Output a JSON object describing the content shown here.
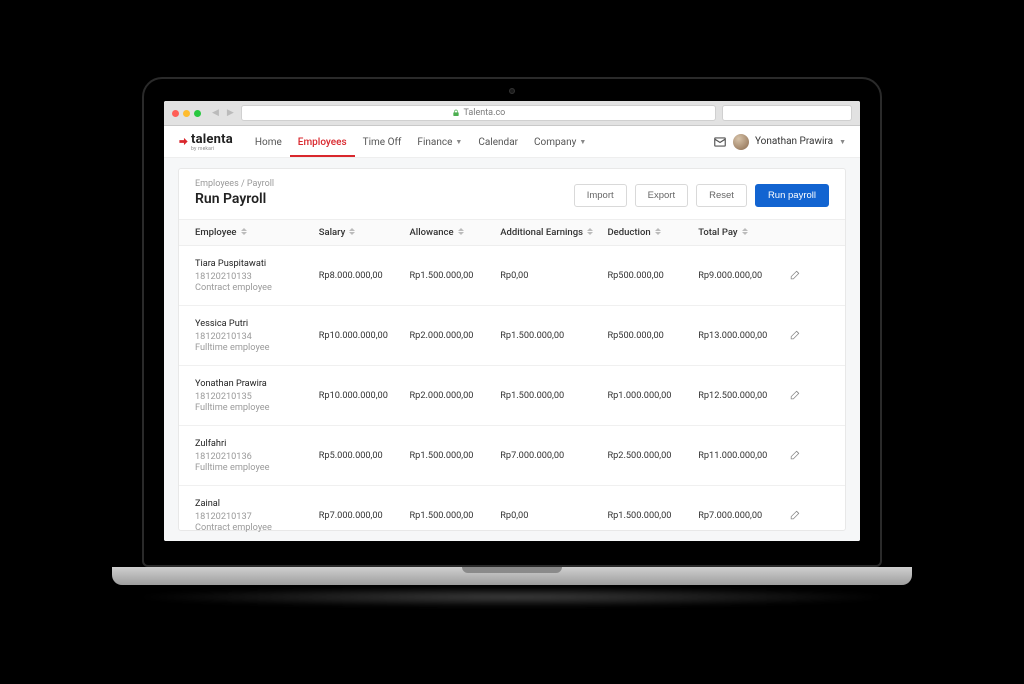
{
  "browser": {
    "url": "Talenta.co"
  },
  "brand": {
    "name": "talenta",
    "tagline": "by mekari"
  },
  "nav": {
    "items": [
      {
        "label": "Home",
        "active": false,
        "caret": false
      },
      {
        "label": "Employees",
        "active": true,
        "caret": false
      },
      {
        "label": "Time Off",
        "active": false,
        "caret": false
      },
      {
        "label": "Finance",
        "active": false,
        "caret": true
      },
      {
        "label": "Calendar",
        "active": false,
        "caret": false
      },
      {
        "label": "Company",
        "active": false,
        "caret": true
      }
    ]
  },
  "user": {
    "name": "Yonathan Prawira"
  },
  "page": {
    "breadcrumb": "Employees / Payroll",
    "title": "Run Payroll",
    "actions": {
      "import": "Import",
      "export": "Export",
      "reset": "Reset",
      "run": "Run payroll"
    }
  },
  "table": {
    "headers": {
      "employee": "Employee",
      "salary": "Salary",
      "allowance": "Allowance",
      "additional": "Additional Earnings",
      "deduction": "Deduction",
      "total": "Total Pay"
    },
    "rows": [
      {
        "name": "Tiara Puspitawati",
        "id": "18120210133",
        "type": "Contract employee",
        "salary": "Rp8.000.000,00",
        "allowance": "Rp1.500.000,00",
        "additional": "Rp0,00",
        "deduction": "Rp500.000,00",
        "total": "Rp9.000.000,00"
      },
      {
        "name": "Yessica Putri",
        "id": "18120210134",
        "type": "Fulltime employee",
        "salary": "Rp10.000.000,00",
        "allowance": "Rp2.000.000,00",
        "additional": "Rp1.500.000,00",
        "deduction": "Rp500.000,00",
        "total": "Rp13.000.000,00"
      },
      {
        "name": "Yonathan Prawira",
        "id": "18120210135",
        "type": "Fulltime employee",
        "salary": "Rp10.000.000,00",
        "allowance": "Rp2.000.000,00",
        "additional": "Rp1.500.000,00",
        "deduction": "Rp1.000.000,00",
        "total": "Rp12.500.000,00"
      },
      {
        "name": "Zulfahri",
        "id": "18120210136",
        "type": "Fulltime employee",
        "salary": "Rp5.000.000,00",
        "allowance": "Rp1.500.000,00",
        "additional": "Rp7.000.000,00",
        "deduction": "Rp2.500.000,00",
        "total": "Rp11.000.000,00"
      },
      {
        "name": "Zainal",
        "id": "18120210137",
        "type": "Contract employee",
        "salary": "Rp7.000.000,00",
        "allowance": "Rp1.500.000,00",
        "additional": "Rp0,00",
        "deduction": "Rp1.500.000,00",
        "total": "Rp7.000.000,00"
      }
    ]
  }
}
